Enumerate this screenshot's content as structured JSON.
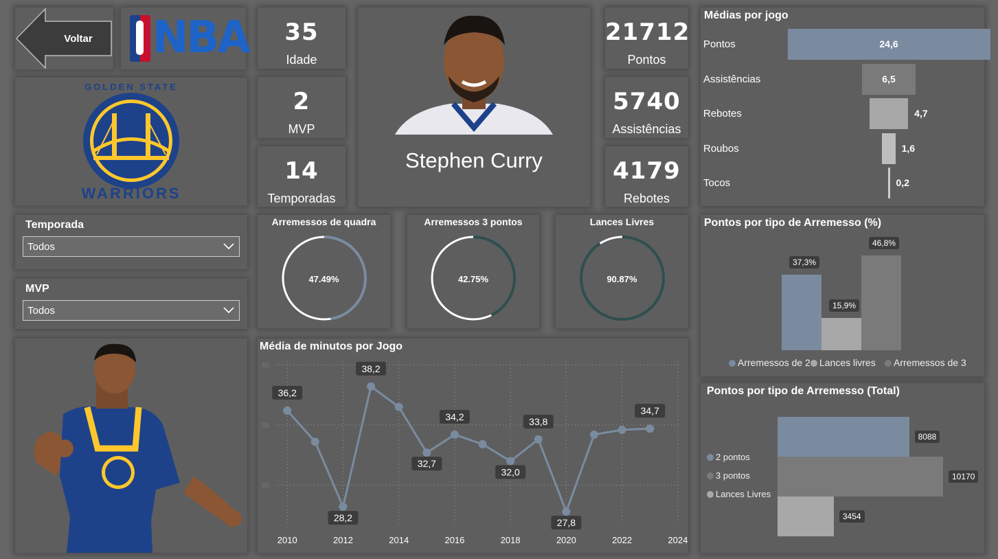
{
  "nav": {
    "back_label": "Voltar"
  },
  "brand": {
    "league": "NBA",
    "team_top": "GOLDEN STATE",
    "team_bottom": "WARRIORS"
  },
  "player": {
    "name": "Stephen Curry"
  },
  "kpis_left": [
    {
      "value": "35",
      "label": "Idade"
    },
    {
      "value": "2",
      "label": "MVP"
    },
    {
      "value": "14",
      "label": "Temporadas"
    }
  ],
  "kpis_right": [
    {
      "value": "21712",
      "label": "Pontos"
    },
    {
      "value": "5740",
      "label": "Assistências"
    },
    {
      "value": "4179",
      "label": "Rebotes"
    }
  ],
  "filters": {
    "season": {
      "label": "Temporada",
      "value": "Todos"
    },
    "mvp": {
      "label": "MVP",
      "value": "Todos"
    }
  },
  "gauges": [
    {
      "title": "Arremessos de quadra",
      "value_label": "47.49%",
      "value": 0.4749,
      "color": "#7a8ba0"
    },
    {
      "title": "Arremessos 3 pontos",
      "value_label": "42.75%",
      "value": 0.4275,
      "color": "#2f4f4f"
    },
    {
      "title": "Lances Livres",
      "value_label": "90.87%",
      "value": 0.9087,
      "color": "#2f4f4f"
    }
  ],
  "averages": {
    "title": "Médias por jogo",
    "max": 24.6,
    "items": [
      {
        "label": "Pontos",
        "value": 24.6,
        "value_label": "24,6",
        "color": "#7a8ba0"
      },
      {
        "label": "Assistências",
        "value": 6.5,
        "value_label": "6,5",
        "color": "#7a7a7a"
      },
      {
        "label": "Rebotes",
        "value": 4.7,
        "value_label": "4,7",
        "color": "#a8a8a8"
      },
      {
        "label": "Roubos",
        "value": 1.6,
        "value_label": "1,6",
        "color": "#bdbdbd"
      },
      {
        "label": "Tocos",
        "value": 0.2,
        "value_label": "0,2",
        "color": "#cccccc"
      }
    ]
  },
  "colors": {
    "series_a": "#7a8ba0",
    "series_b": "#a8a8a8",
    "series_c": "#7a7a7a",
    "line": "#7a8ba0",
    "background": "#666666",
    "card": "#5e5e5e"
  },
  "chart_data": [
    {
      "type": "line",
      "title": "Média de minutos por Jogo",
      "xlabel": "",
      "ylabel": "",
      "x_ticks": [
        2010,
        2012,
        2014,
        2016,
        2018,
        2020,
        2022,
        2024
      ],
      "y_ticks": [
        30,
        35,
        40
      ],
      "xlim": [
        2009.6,
        2024.2
      ],
      "ylim": [
        26.6,
        40.3
      ],
      "grid": true,
      "x": [
        2010,
        2011,
        2012,
        2013,
        2014,
        2015,
        2016,
        2017,
        2018,
        2019,
        2020,
        2021,
        2022,
        2023
      ],
      "y": [
        36.2,
        33.6,
        28.2,
        38.2,
        36.5,
        32.7,
        34.2,
        33.4,
        32.0,
        33.8,
        27.8,
        34.2,
        34.6,
        34.7
      ],
      "labels": [
        "36,2",
        "",
        "28,2",
        "38,2",
        "",
        "32,7",
        "34,2",
        "",
        "32,0",
        "33,8",
        "27,8",
        "",
        "",
        "34,7"
      ]
    },
    {
      "type": "bar",
      "title": "Pontos por tipo de Arremesso (%)",
      "categories": [
        "Arremessos de 2",
        "Lances livres",
        "Arremessos de 3"
      ],
      "values": [
        37.3,
        15.9,
        46.8
      ],
      "value_labels": [
        "37,3%",
        "15,9%",
        "46,8%"
      ],
      "legend": "bottom"
    },
    {
      "type": "bar",
      "orientation": "horizontal",
      "title": "Pontos por tipo de Arremesso (Total)",
      "categories": [
        "2 pontos",
        "3 pontos",
        "Lances Livres"
      ],
      "values": [
        8088,
        10170,
        3454
      ],
      "value_labels": [
        "8088",
        "10170",
        "3454"
      ],
      "legend": "left"
    }
  ]
}
